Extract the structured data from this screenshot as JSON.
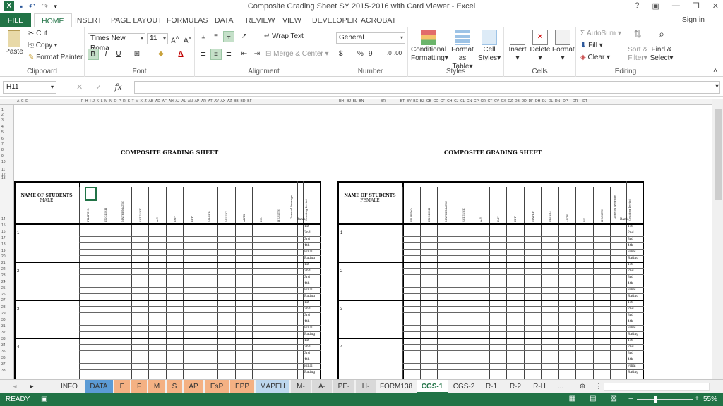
{
  "window": {
    "title": "Composite Grading Sheet SY 2015-2016 with Card Viewer - Excel",
    "help": "?",
    "controls": [
      "▣",
      "—",
      "❐",
      "✕"
    ]
  },
  "ribbon_tabs": [
    "FILE",
    "HOME",
    "INSERT",
    "PAGE LAYOUT",
    "FORMULAS",
    "DATA",
    "REVIEW",
    "VIEW",
    "DEVELOPER",
    "ACROBAT"
  ],
  "signin": "Sign in",
  "clipboard": {
    "paste": "Paste",
    "cut": "Cut",
    "copy": "Copy",
    "format_painter": "Format Painter",
    "label": "Clipboard"
  },
  "font": {
    "name": "Times New Roma",
    "size": "11",
    "bold": "B",
    "italic": "I",
    "underline": "U",
    "label": "Font"
  },
  "alignment": {
    "wrap": "Wrap Text",
    "merge": "Merge & Center",
    "label": "Alignment"
  },
  "number": {
    "format": "General",
    "currency": "$",
    "percent": "%",
    "comma": "9",
    "label": "Number"
  },
  "styles": {
    "conditional": "Conditional",
    "conditional2": "Formatting",
    "format_table": "Format as",
    "format_table2": "Table",
    "cell_styles": "Cell",
    "cell_styles2": "Styles",
    "label": "Styles"
  },
  "cells": {
    "insert": "Insert",
    "delete": "Delete",
    "format": "Format",
    "label": "Cells"
  },
  "editing": {
    "autosum": "AutoSum",
    "fill": "Fill",
    "clear": "Clear",
    "sort": "Sort &",
    "sort2": "Filter",
    "find": "Find &",
    "find2": "Select",
    "label": "Editing"
  },
  "formula_bar": {
    "name_box": "H11",
    "fx": "fx",
    "cancel": "✕",
    "enter": "✓",
    "value": ""
  },
  "sheet": {
    "title_left": "COMPOSITE GRADING SHEET",
    "title_right": "COMPOSITE GRADING SHEET",
    "names_header": "NAME OF STUDENTS",
    "male": "MALE",
    "female": "FEMALE",
    "subjects": [
      "FILIPINO",
      "ENGLISH",
      "MATHEMATIC",
      "SCIENCE",
      "A.P.",
      "EsP",
      "EPP",
      "MAPEH",
      "MUSIC",
      "ARTS",
      "P.E.",
      "HEALTH"
    ],
    "general_average": "General Average",
    "rank": "Rank",
    "grading_period": "Grading Period",
    "periods": [
      "1st",
      "2nd",
      "3rd",
      "4th",
      "Final",
      "Rating"
    ],
    "students": [
      "1",
      "2",
      "3",
      "4"
    ]
  },
  "sheet_tabs": [
    "INFO",
    "DATA",
    "E",
    "F",
    "M",
    "S",
    "AP",
    "EsP",
    "EPP",
    "MAPEH",
    "M-",
    "A-",
    "PE-",
    "H-",
    "FORM138",
    "CGS-1",
    "CGS-2",
    "R-1",
    "R-2",
    "R-H",
    "..."
  ],
  "sheet_tab_colors": {
    "DATA": "#5b9bd5",
    "E": "#f4b183",
    "F": "#f4b183",
    "M": "#f4b183",
    "S": "#f4b183",
    "AP": "#f4b183",
    "EsP": "#f4b183",
    "EPP": "#f4b183",
    "MAPEH": "#bdd7ee",
    "M-": "#d9d9d9",
    "A-": "#d9d9d9",
    "PE-": "#d9d9d9",
    "H-": "#d9d9d9"
  },
  "status": {
    "ready": "READY",
    "zoom": "55%"
  },
  "accent": "#217346"
}
